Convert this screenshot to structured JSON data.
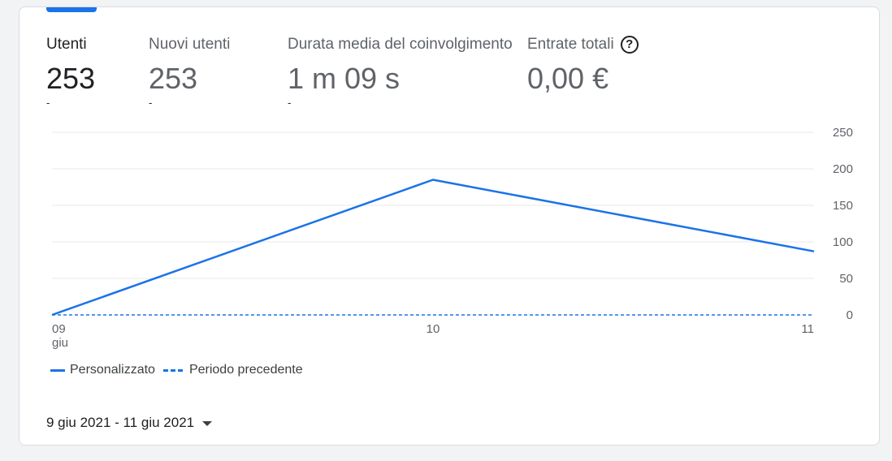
{
  "metrics": [
    {
      "label": "Utenti",
      "value": "253",
      "delta": "-",
      "selected": true
    },
    {
      "label": "Nuovi utenti",
      "value": "253",
      "delta": "-"
    },
    {
      "label": "Durata media del coinvolgimento",
      "value": "1 m 09 s",
      "delta": "-"
    },
    {
      "label": "Entrate totali",
      "value": "0,00 €",
      "delta": ""
    }
  ],
  "help_icon": "question-circle-icon",
  "chart_data": {
    "type": "line",
    "x": [
      "09",
      "10",
      "11"
    ],
    "x_sublabel": "giu",
    "yticks": [
      "0",
      "50",
      "100",
      "150",
      "200",
      "250"
    ],
    "ylim": [
      0,
      250
    ],
    "grid": true,
    "series": [
      {
        "name": "Personalizzato",
        "values": [
          0,
          185,
          87
        ],
        "style": "solid",
        "color": "#1a73e8"
      },
      {
        "name": "Periodo precedente",
        "values": [
          0,
          0,
          0
        ],
        "style": "dashed",
        "color": "#1a73e8"
      }
    ]
  },
  "legend": {
    "solid_label": "Personalizzato",
    "dashed_label": "Periodo precedente"
  },
  "date_range": "9 giu 2021 - 11 giu 2021"
}
